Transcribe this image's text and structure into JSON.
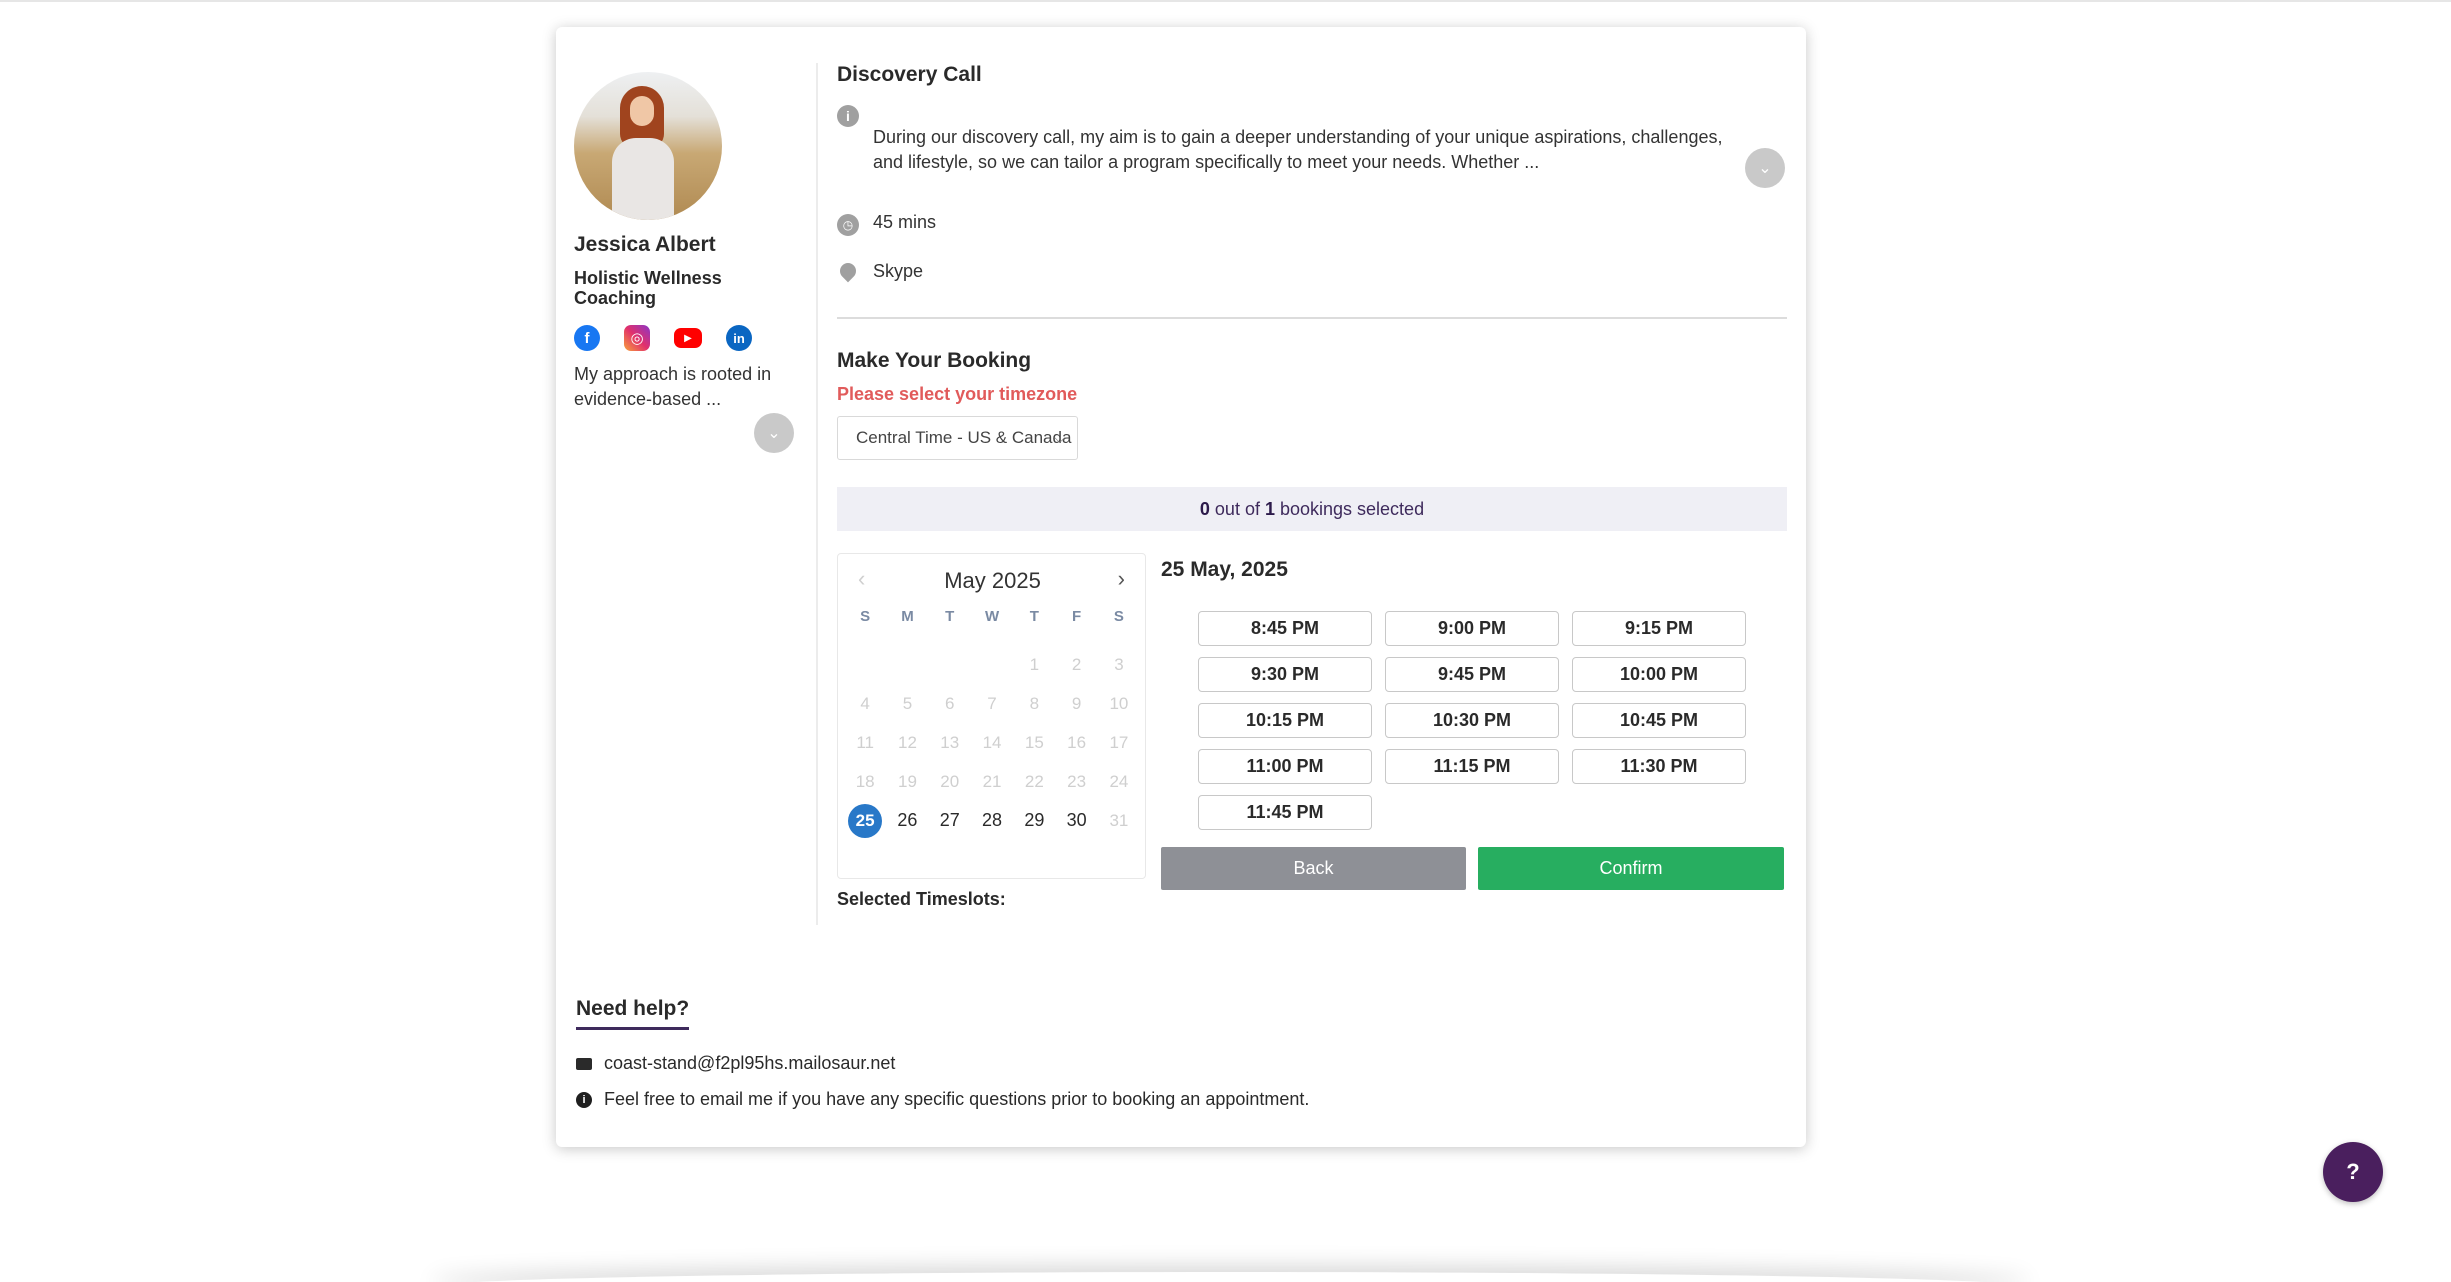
{
  "provider": {
    "name": "Jessica Albert",
    "title": "Holistic Wellness Coaching",
    "bio": "My approach is rooted in evidence-based ...",
    "socials": [
      {
        "name": "facebook-icon",
        "glyph": "f",
        "color": "#1877f2"
      },
      {
        "name": "instagram-icon",
        "glyph": "◎",
        "color": "#e1306c"
      },
      {
        "name": "youtube-icon",
        "glyph": "▶",
        "color": "#ff0000"
      },
      {
        "name": "linkedin-icon",
        "glyph": "in",
        "color": "#0a66c2"
      }
    ]
  },
  "event": {
    "title": "Discovery Call",
    "description": "During our discovery call, my aim is to gain a deeper understanding of your unique aspirations, challenges, and lifestyle, so we can tailor a program specifically to meet your needs. Whether ...",
    "duration": "45 mins",
    "location": "Skype"
  },
  "booking": {
    "title": "Make Your Booking",
    "timezone_prompt": "Please select your timezone",
    "timezone_value": "Central Time - US & Canada",
    "selected_count": "0",
    "selected_mid": " out of ",
    "selected_total": "1",
    "selected_suffix": " bookings selected",
    "selected_timeslots_label": "Selected Timeslots:"
  },
  "calendar": {
    "month_label": "May 2025",
    "prev_glyph": "‹",
    "next_glyph": "›",
    "weekdays": [
      "S",
      "M",
      "T",
      "W",
      "T",
      "F",
      "S"
    ],
    "days": [
      "",
      "",
      "",
      "",
      "1",
      "2",
      "3",
      "4",
      "5",
      "6",
      "7",
      "8",
      "9",
      "10",
      "11",
      "12",
      "13",
      "14",
      "15",
      "16",
      "17",
      "18",
      "19",
      "20",
      "21",
      "22",
      "23",
      "24",
      "25",
      "26",
      "27",
      "28",
      "29",
      "30",
      "31"
    ],
    "available": [
      "25",
      "26",
      "27",
      "28",
      "29",
      "30"
    ],
    "selected": "25"
  },
  "slots_panel": {
    "date_title": "25 May, 2025",
    "times": [
      "8:45 PM",
      "9:00 PM",
      "9:15 PM",
      "9:30 PM",
      "9:45 PM",
      "10:00 PM",
      "10:15 PM",
      "10:30 PM",
      "10:45 PM",
      "11:00 PM",
      "11:15 PM",
      "11:30 PM",
      "11:45 PM"
    ],
    "back_label": "Back",
    "confirm_label": "Confirm"
  },
  "help": {
    "title": "Need help?",
    "email": "coast-stand@f2pl95hs.mailosaur.net",
    "note": "Feel free to email me if you have any specific questions prior to booking an appointment.",
    "fab_label": "?"
  },
  "colors": {
    "accent": "#3e2a5c",
    "warning": "#e15b5b",
    "confirm": "#27ae60",
    "back": "#8e9096",
    "selected_day": "#2878c8"
  }
}
